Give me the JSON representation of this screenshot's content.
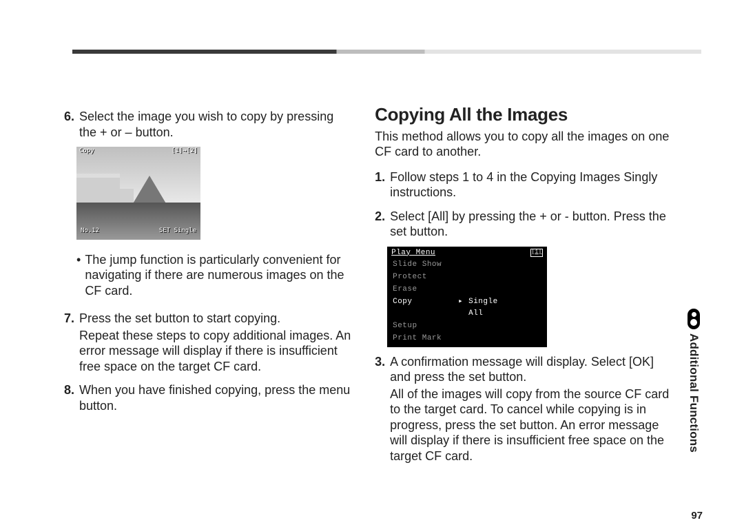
{
  "page_number": "97",
  "side_tab": "Additional Functions",
  "left": {
    "step6_num": "6.",
    "step6_text": "Select the image you wish to copy by pressing the + or – button.",
    "preview": {
      "top_left": "Copy",
      "top_right": "[1]→[2]",
      "bottom_left": "No.12",
      "bottom_right": "SET Single"
    },
    "step6_bullet": "The jump function is particularly convenient for navigating if there are numerous images on the CF card.",
    "step7_num": "7.",
    "step7_lead": "Press the set button to start copying.",
    "step7_sub": "Repeat these steps to copy additional images. An error message will display if there is insufficient free space on the target CF card.",
    "step8_num": "8.",
    "step8_text": "When you have finished copying, press the menu button."
  },
  "right": {
    "heading": "Copying All the Images",
    "intro": "This method allows you to copy all the images on one CF card to another.",
    "step1_num": "1.",
    "step1_text": "Follow steps 1 to 4 in the Copying Images Singly instructions.",
    "step2_num": "2.",
    "step2_text": "Select [All] by pressing the + or - button. Press the set button.",
    "menu": {
      "title": "Play Menu",
      "card_icon": "[1]",
      "items": [
        {
          "l": "Slide Show",
          "r": ""
        },
        {
          "l": "Protect",
          "r": ""
        },
        {
          "l": "Erase",
          "r": ""
        },
        {
          "l": "Copy",
          "arrow": "▸",
          "r": "Single",
          "selected": true
        },
        {
          "l": "",
          "r": "All",
          "highlight_r": true
        },
        {
          "l": "Setup",
          "r": ""
        },
        {
          "l": "Print Mark",
          "r": ""
        }
      ]
    },
    "step3_num": "3.",
    "step3_lead": "A confirmation message will display. Select [OK] and press the set button.",
    "step3_sub": "All of the images will copy from the source CF card to the target card. To cancel while copying is in progress, press the set button. An error message will display if there is insufficient free space on the target CF card."
  }
}
